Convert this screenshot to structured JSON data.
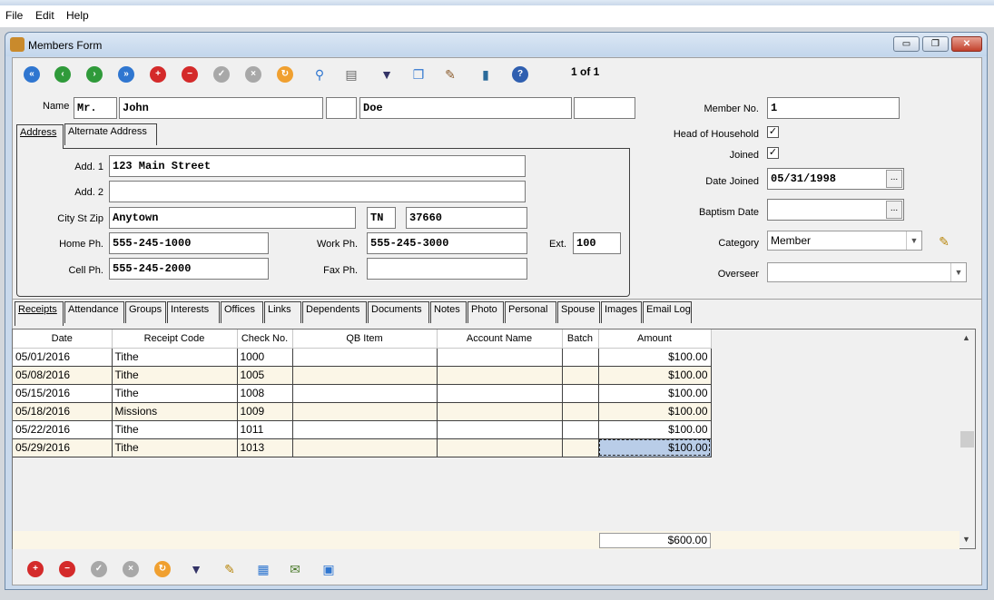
{
  "menu": {
    "file": "File",
    "edit": "Edit",
    "help": "Help"
  },
  "window": {
    "title": "Members Form",
    "minimize": "▭",
    "restore": "❐",
    "close": "✕"
  },
  "toolbar": {
    "record_counter": "1 of 1",
    "icons": [
      "first-record-icon",
      "previous-record-icon",
      "next-record-icon",
      "last-record-icon",
      "add-record-icon",
      "delete-record-icon",
      "save-icon",
      "cancel-icon",
      "refresh-icon",
      "search-icon",
      "print-icon",
      "filter-icon",
      "copy-icon",
      "tools-icon",
      "exit-icon",
      "help-icon"
    ]
  },
  "name": {
    "label": "Name",
    "prefix": "Mr.",
    "first": "John",
    "middle": "",
    "last": "Doe",
    "suffix": ""
  },
  "address_tabs": {
    "address": "Address",
    "alternate": "Alternate Address"
  },
  "address": {
    "add1_label": "Add. 1",
    "add1": "123 Main Street",
    "add2_label": "Add. 2",
    "add2": "",
    "city_label": "City St Zip",
    "city": "Anytown",
    "state": "TN",
    "zip": "37660",
    "home_label": "Home Ph.",
    "home": "555-245-1000",
    "work_label": "Work Ph.",
    "work": "555-245-3000",
    "ext_label": "Ext.",
    "ext": "100",
    "cell_label": "Cell Ph.",
    "cell": "555-245-2000",
    "fax_label": "Fax Ph.",
    "fax": ""
  },
  "member": {
    "member_no_label": "Member No.",
    "member_no": "1",
    "head_label": "Head of Household",
    "head_checked": "✓",
    "joined_label": "Joined",
    "joined_checked": "✓",
    "date_joined_label": "Date Joined",
    "date_joined": "05/31/1998",
    "baptism_label": "Baptism Date",
    "baptism": "",
    "category_label": "Category",
    "category": "Member",
    "overseer_label": "Overseer",
    "overseer": "",
    "dots": "..."
  },
  "tabs": [
    "Receipts",
    "Attendance",
    "Groups",
    "Interests",
    "Offices",
    "Links",
    "Dependents",
    "Documents",
    "Notes",
    "Photo",
    "Personal",
    "Spouse",
    "Images",
    "Email Log"
  ],
  "receipts": {
    "columns": [
      "Date",
      "Receipt Code",
      "Check No.",
      "QB Item",
      "Account Name",
      "Batch",
      "Amount"
    ],
    "rows": [
      [
        "05/01/2016",
        "Tithe",
        "1000",
        "",
        "",
        "",
        "$100.00"
      ],
      [
        "05/08/2016",
        "Tithe",
        "1005",
        "",
        "",
        "",
        "$100.00"
      ],
      [
        "05/15/2016",
        "Tithe",
        "1008",
        "",
        "",
        "",
        "$100.00"
      ],
      [
        "05/18/2016",
        "Missions",
        "1009",
        "",
        "",
        "",
        "$100.00"
      ],
      [
        "05/22/2016",
        "Tithe",
        "1011",
        "",
        "",
        "",
        "$100.00"
      ],
      [
        "05/29/2016",
        "Tithe",
        "1013",
        "",
        "",
        "",
        "$100.00"
      ]
    ],
    "total": "$600.00"
  },
  "bottom_toolbar": {
    "icons": [
      "add-receipt-icon",
      "delete-receipt-icon",
      "save-receipt-icon",
      "cancel-receipt-icon",
      "refresh-receipt-icon",
      "filter-receipt-icon",
      "category-receipt-icon",
      "calculator-icon",
      "envelope-icon",
      "report-icon"
    ]
  },
  "scroll": {
    "up": "▲",
    "down": "▼"
  }
}
